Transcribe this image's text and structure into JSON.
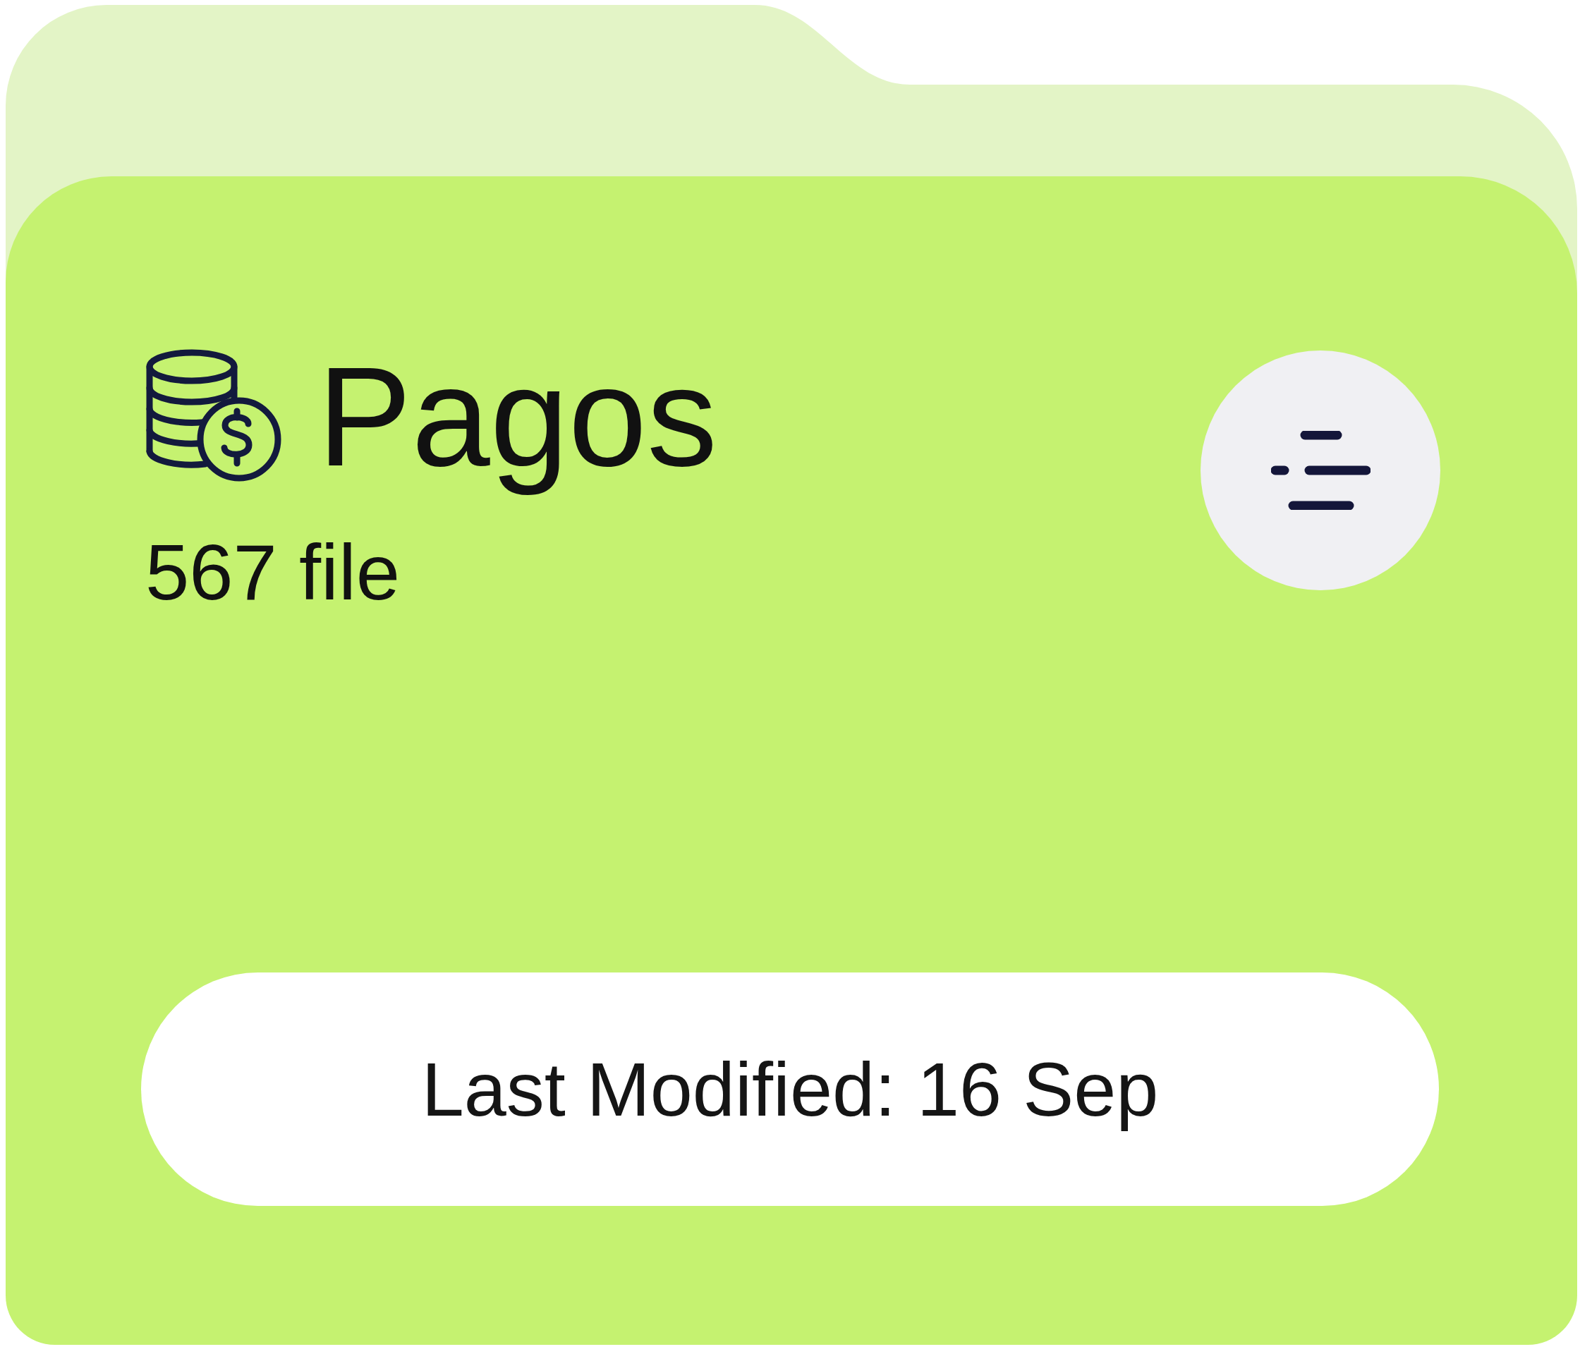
{
  "folder": {
    "name": "Pagos",
    "file_count": "567 file",
    "last_modified": "Last Modified: 16 Sep"
  }
}
